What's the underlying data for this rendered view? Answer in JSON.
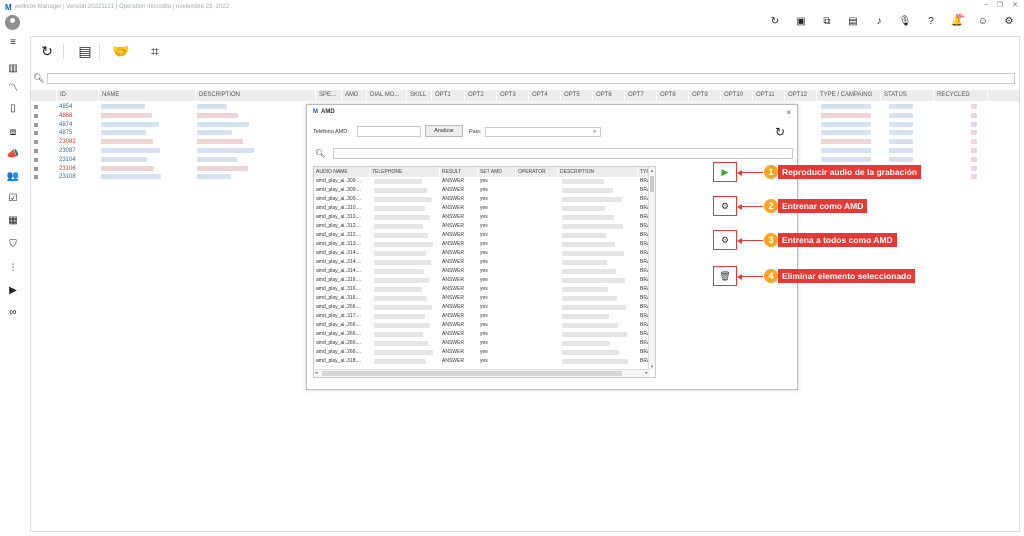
{
  "window": {
    "logo": "M",
    "title": "wolkvox Manager | Version 20221121 | Operation microdllo | noviembre 23, 2022",
    "controls": [
      "–",
      "❐",
      "✕"
    ]
  },
  "top_icons": [
    {
      "name": "refresh-icon",
      "glyph": "↻"
    },
    {
      "name": "briefcase-icon",
      "glyph": "▣"
    },
    {
      "name": "copy-icon",
      "glyph": "⧉"
    },
    {
      "name": "id-card-icon",
      "glyph": "▤"
    },
    {
      "name": "music-icon",
      "glyph": "♪"
    },
    {
      "name": "microphone-icon",
      "glyph": "🎙"
    },
    {
      "name": "help-icon",
      "glyph": "?"
    },
    {
      "name": "bell-icon",
      "glyph": "🔔",
      "badge": "99+"
    },
    {
      "name": "user-icon",
      "glyph": "☺"
    },
    {
      "name": "settings-icon",
      "glyph": "⚙"
    }
  ],
  "sidebar_icons": [
    {
      "name": "menu-icon",
      "glyph": "≡"
    },
    {
      "name": "bar-chart-icon",
      "glyph": "▥"
    },
    {
      "name": "trend-icon",
      "glyph": "〽"
    },
    {
      "name": "document-icon",
      "glyph": "▯"
    },
    {
      "name": "workflow-icon",
      "glyph": "⧈"
    },
    {
      "name": "megaphone-icon",
      "glyph": "📣"
    },
    {
      "name": "users-icon",
      "glyph": "👥"
    },
    {
      "name": "checklist-icon",
      "glyph": "☑"
    },
    {
      "name": "report-icon",
      "glyph": "▦"
    },
    {
      "name": "shield-icon",
      "glyph": "⛉"
    },
    {
      "name": "audio-wave-icon",
      "glyph": "⫶"
    },
    {
      "name": "video-icon",
      "glyph": "▶"
    },
    {
      "name": "voicemail-icon",
      "glyph": "∞"
    }
  ],
  "toolbar": [
    {
      "name": "refresh-icon",
      "glyph": "↻"
    },
    {
      "name": "add-list-icon",
      "glyph": "▤"
    },
    {
      "name": "handshake-icon",
      "glyph": "🤝"
    },
    {
      "name": "chip-icon",
      "glyph": "⌗"
    }
  ],
  "grid": {
    "columns": [
      "ID",
      "NAME",
      "DESCRIPTION",
      "SPE...",
      "AMD",
      "DIAL MO...",
      "SKILL",
      "OPT1",
      "OPT2",
      "OPT3",
      "OPT4",
      "OPT5",
      "OPT6",
      "OPT7",
      "OPT8",
      "OPT9",
      "OPT10",
      "OPT11",
      "OPT12",
      "TYPE / CAMPAING",
      "STATUS",
      "RECYCLED"
    ],
    "rows": [
      {
        "id": "4854",
        "color": "#2e6da4"
      },
      {
        "id": "4868",
        "color": "#c0392b"
      },
      {
        "id": "4874",
        "color": "#2e6da4"
      },
      {
        "id": "4875",
        "color": "#2e6da4"
      },
      {
        "id": "23082",
        "color": "#c0392b"
      },
      {
        "id": "23087",
        "color": "#2e6da4"
      },
      {
        "id": "23104",
        "color": "#2e6da4"
      },
      {
        "id": "23106",
        "color": "#c0392b"
      },
      {
        "id": "23108",
        "color": "#2e6da4"
      }
    ]
  },
  "dialog": {
    "logo": "M",
    "title": "AMD",
    "close": "×",
    "telefono_label": "Teléfono AMD:",
    "analizar_label": "Analizar",
    "pais_label": "Pais:",
    "pais_arrow": "▾",
    "columns": [
      "AUDIO NAME",
      "TELEPHONE",
      "RESULT",
      "SET AMD",
      "OPERATOR",
      "DESCRIPTION",
      "TYP"
    ],
    "rows": [
      {
        "audio": "amd_play_ai..309....",
        "result": "ANSWER",
        "set": "yes",
        "typ": "BRA"
      },
      {
        "audio": "amd_play_ai..309....",
        "result": "ANSWER",
        "set": "yes",
        "typ": "BRA"
      },
      {
        "audio": "amd_play_ai..309....",
        "result": "ANSWER",
        "set": "yes",
        "typ": "BRA"
      },
      {
        "audio": "amd_play_ai..310....",
        "result": "ANSWER",
        "set": "yes",
        "typ": "BRA"
      },
      {
        "audio": "amd_play_ai..310....",
        "result": "ANSWER",
        "set": "yes",
        "typ": "BRA"
      },
      {
        "audio": "amd_play_ai..312....",
        "result": "ANSWER",
        "set": "yes",
        "typ": "BRA"
      },
      {
        "audio": "amd_play_ai..312....",
        "result": "ANSWER",
        "set": "yes",
        "typ": "BRA"
      },
      {
        "audio": "amd_play_ai..313....",
        "result": "ANSWER",
        "set": "yes",
        "typ": "BRA"
      },
      {
        "audio": "amd_play_ai..314....",
        "result": "ANSWER",
        "set": "yes",
        "typ": "BRA"
      },
      {
        "audio": "amd_play_ai..314....",
        "result": "ANSWER",
        "set": "yes",
        "typ": "BRA"
      },
      {
        "audio": "amd_play_ai..314....",
        "result": "ANSWER",
        "set": "yes",
        "typ": "BRA"
      },
      {
        "audio": "amd_play_ai..316....",
        "result": "ANSWER",
        "set": "yes",
        "typ": "BRA"
      },
      {
        "audio": "amd_play_ai..316....",
        "result": "ANSWER",
        "set": "yes",
        "typ": "BRA"
      },
      {
        "audio": "amd_play_ai..316....",
        "result": "ANSWER",
        "set": "yes",
        "typ": "BRA"
      },
      {
        "audio": "amd_play_ai..266....",
        "result": "ANSWER",
        "set": "yes",
        "typ": "BRA"
      },
      {
        "audio": "amd_play_ai..317....",
        "result": "ANSWER",
        "set": "yes",
        "typ": "BRA"
      },
      {
        "audio": "amd_play_ai..266....",
        "result": "ANSWER",
        "set": "yes",
        "typ": "BRA"
      },
      {
        "audio": "amd_play_ai..266....",
        "result": "ANSWER",
        "set": "yes",
        "typ": "BRA"
      },
      {
        "audio": "amd_play_ai..266....",
        "result": "ANSWER",
        "set": "yes",
        "typ": "BRA"
      },
      {
        "audio": "amd_play_ai..266....",
        "result": "ANSWER",
        "set": "yes",
        "typ": "BRA"
      },
      {
        "audio": "amd_play_ai..318....",
        "result": "ANSWER",
        "set": "yes",
        "typ": "BRA"
      }
    ]
  },
  "callouts": [
    {
      "num": "1",
      "label": "Reproducir audio de la grabación",
      "icon": "play-icon",
      "glyph": "▶",
      "glyph_color": "#3aa52c"
    },
    {
      "num": "2",
      "label": "Entrenar como AMD",
      "icon": "train-amd-icon",
      "glyph": "⚙",
      "glyph_color": "#333"
    },
    {
      "num": "3",
      "label": "Entrena a todos como AMD",
      "icon": "train-all-amd-icon",
      "glyph": "⚙",
      "glyph_color": "#333"
    },
    {
      "num": "4",
      "label": "Eliminar elemento seleccionado",
      "icon": "trash-icon",
      "glyph": "🗑",
      "glyph_color": "#333"
    }
  ],
  "colors": {
    "accent": "#e53935",
    "number_badge": "#f5a623",
    "link_blue": "#2e6da4",
    "link_red": "#c0392b"
  }
}
